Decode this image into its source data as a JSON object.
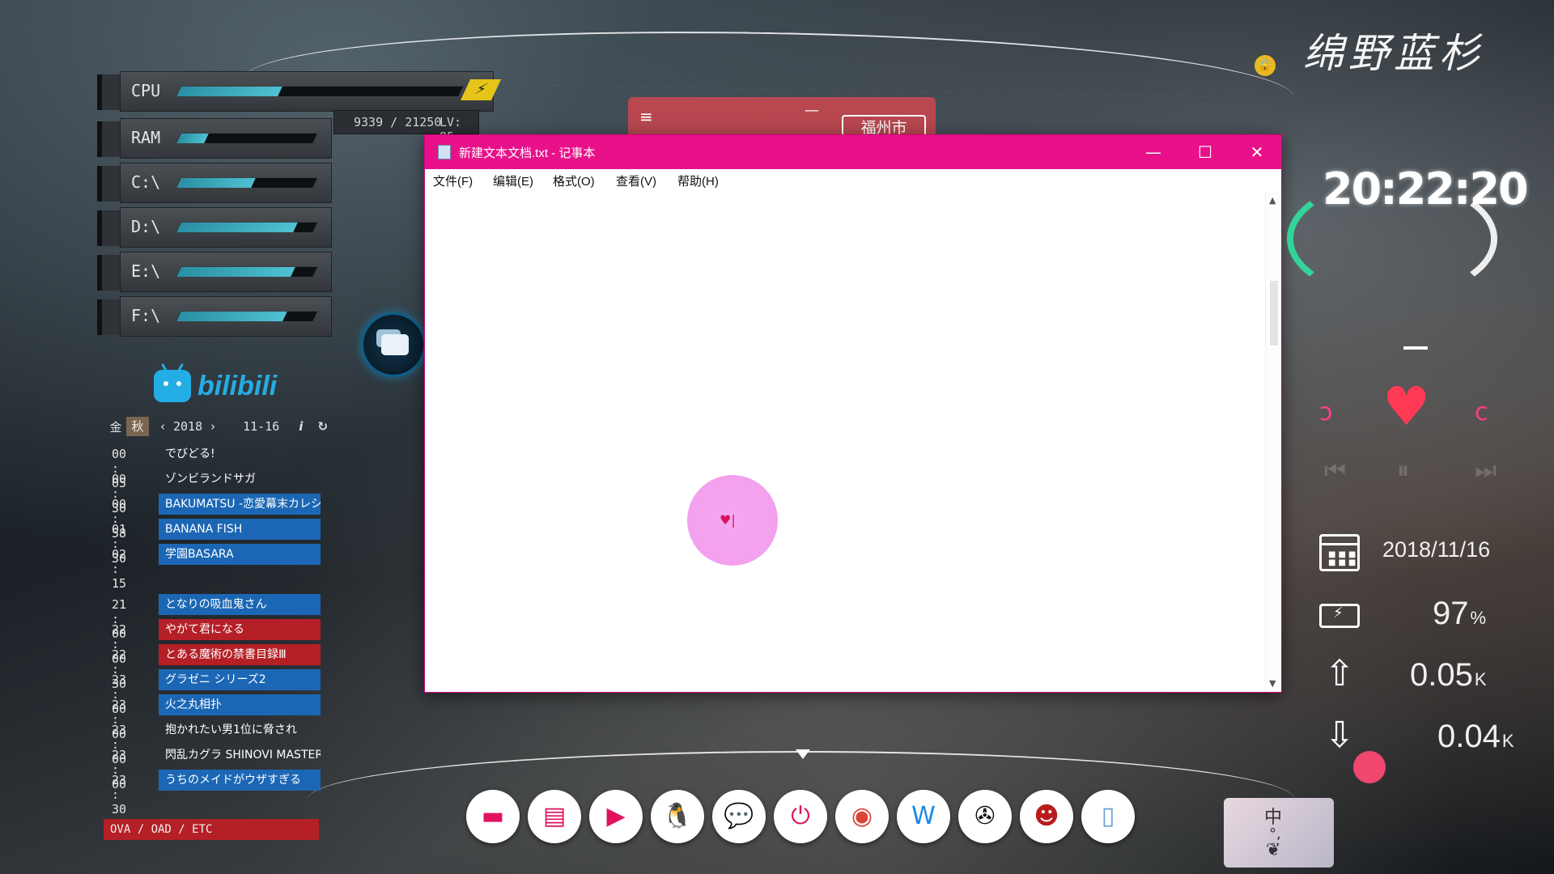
{
  "monitor": {
    "cpu": {
      "label": "CPU",
      "value": 0.36
    },
    "exp": "9339 / 21250",
    "level": "LV: 85",
    "rows": [
      {
        "label": "RAM",
        "value": 0.2
      },
      {
        "label": "C:\\",
        "value": 0.55
      },
      {
        "label": "D:\\",
        "value": 0.86
      },
      {
        "label": "E:\\",
        "value": 0.84
      },
      {
        "label": "F:\\",
        "value": 0.78
      }
    ]
  },
  "weather": {
    "city": "福州市",
    "menu_icon": "≡",
    "minimize": "—"
  },
  "bilibili": {
    "logo_text": "bilibili",
    "header": {
      "day": "金",
      "season": "秋",
      "prev": "‹",
      "year": "2018",
      "next": "›",
      "date": "11-16",
      "info": "i",
      "refresh": "↻"
    },
    "schedule": [
      {
        "time": "00 : 05",
        "title": "でびどる!",
        "style": "plain"
      },
      {
        "time": "00 : 30",
        "title": "ゾンビランドサガ",
        "style": "plain"
      },
      {
        "time": "00 : 58",
        "title": "BAKUMATSU -恋愛幕末カレシ",
        "style": "blue"
      },
      {
        "time": "01 : 30",
        "title": "BANANA FISH",
        "style": "blue"
      },
      {
        "time": "02 : 15",
        "title": "学園BASARA",
        "style": "blue"
      },
      {
        "time": "21 : 00",
        "title": "となりの吸血鬼さん",
        "style": "blue"
      },
      {
        "time": "22 : 00",
        "title": "やがて君になる",
        "style": "red"
      },
      {
        "time": "22 : 30",
        "title": "とある魔術の禁書目録Ⅲ",
        "style": "red"
      },
      {
        "time": "23 : 00",
        "title": "グラゼニ シリーズ2",
        "style": "blue"
      },
      {
        "time": "23 : 00",
        "title": "火之丸相扑",
        "style": "blue"
      },
      {
        "time": "23 : 00",
        "title": "抱かれたい男1位に脅され",
        "style": "plain"
      },
      {
        "time": "23 : 00",
        "title": "閃乱カグラ SHINOVI MASTER -",
        "style": "plain"
      },
      {
        "time": "23 : 30",
        "title": "うちのメイドがウザすぎる",
        "style": "blue"
      }
    ],
    "footer": "OVA / OAD / ETC"
  },
  "notepad": {
    "title": "新建文本文档.txt - 记事本",
    "menus": [
      "文件(F)",
      "编辑(E)",
      "格式(O)",
      "查看(V)",
      "帮助(H)"
    ],
    "controls": {
      "minimize": "—",
      "maximize": "☐",
      "close": "✕"
    },
    "content": ""
  },
  "right_panel": {
    "signature": "绵野蓝杉",
    "clock": "20:22:20",
    "date": "2018/11/16",
    "battery": "97",
    "battery_unit": "%",
    "upload": "0.05",
    "upload_unit": "K",
    "download": "0.04",
    "download_unit": "K"
  },
  "dock": [
    {
      "name": "desktop-icon",
      "glyph": "▬",
      "color": "#e0115f"
    },
    {
      "name": "presentation-icon",
      "glyph": "▤",
      "color": "#e0115f"
    },
    {
      "name": "video-player-icon",
      "glyph": "▶",
      "color": "#e0115f"
    },
    {
      "name": "qq-penguin-icon",
      "glyph": "🐧",
      "color": "#111111"
    },
    {
      "name": "wechat-icon",
      "glyph": "💬",
      "color": "#2bb24c"
    },
    {
      "name": "power-icon",
      "glyph": "⏻",
      "color": "#e0115f"
    },
    {
      "name": "chrome-icon",
      "glyph": "◉",
      "color": "#db4437"
    },
    {
      "name": "wps-icon",
      "glyph": "W",
      "color": "#1e88e5"
    },
    {
      "name": "fan-icon",
      "glyph": "✇",
      "color": "#111111"
    },
    {
      "name": "ironman-icon",
      "glyph": "☻",
      "color": "#b71c1c"
    },
    {
      "name": "document-icon",
      "glyph": "▯",
      "color": "#6a9fd4"
    }
  ],
  "ime": {
    "mode": "中",
    "punct": "°,",
    "icon": "❦"
  }
}
